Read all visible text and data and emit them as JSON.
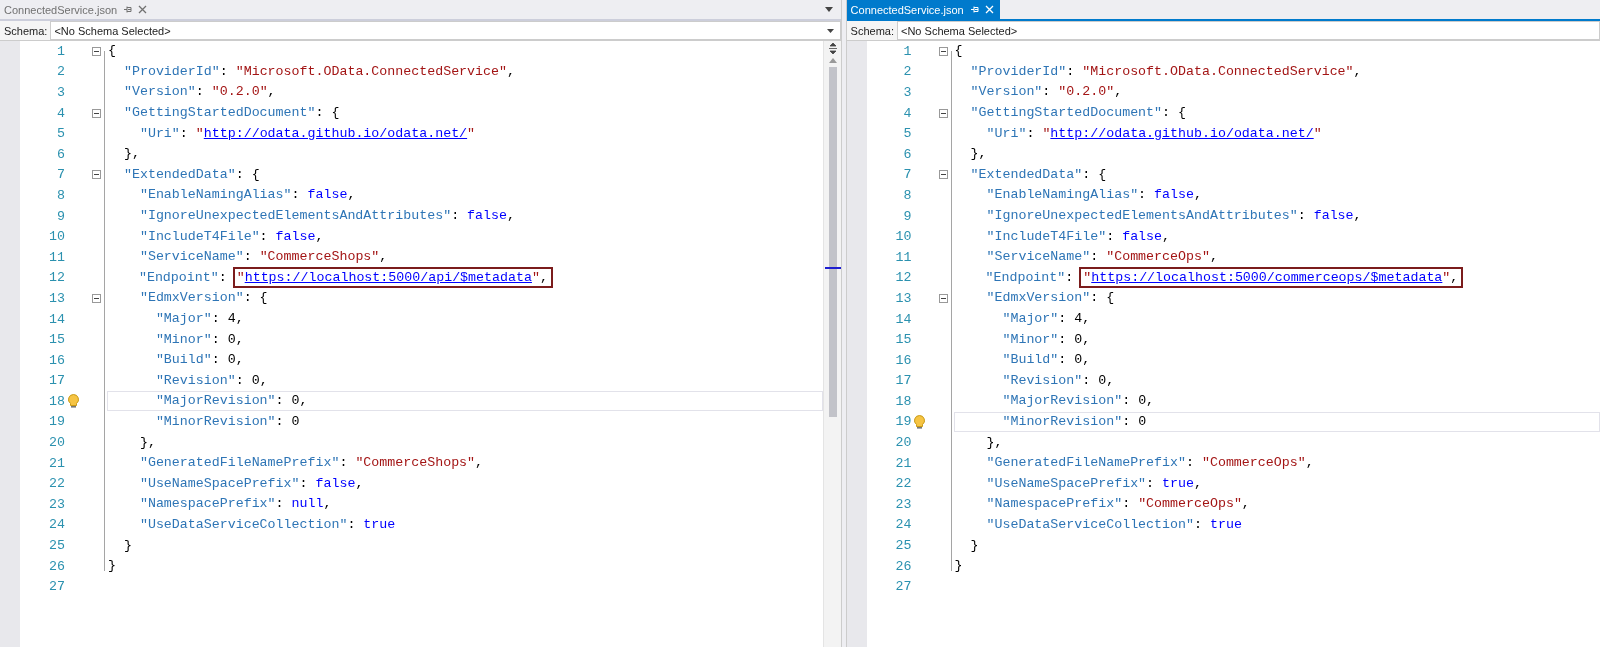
{
  "panes": [
    {
      "tab": {
        "label": "ConnectedService.json",
        "selected": false
      },
      "schema": {
        "label": "Schema:",
        "value": "<No Schema Selected>"
      },
      "scrollbar": true,
      "lines": [
        {
          "n": "1",
          "fold": true,
          "current": false,
          "tokens": [
            {
              "kind": "punctuation",
              "text": "{"
            }
          ]
        },
        {
          "n": "2",
          "fold": false,
          "current": false,
          "tokens": [
            {
              "kind": "key",
              "text": "  \"ProviderId\""
            },
            {
              "kind": "punctuation",
              "text": ": "
            },
            {
              "kind": "string",
              "text": "\"Microsoft.OData.ConnectedService\""
            },
            {
              "kind": "punctuation",
              "text": ","
            }
          ]
        },
        {
          "n": "3",
          "fold": false,
          "current": false,
          "tokens": [
            {
              "kind": "key",
              "text": "  \"Version\""
            },
            {
              "kind": "punctuation",
              "text": ": "
            },
            {
              "kind": "string",
              "text": "\"0.2.0\""
            },
            {
              "kind": "punctuation",
              "text": ","
            }
          ]
        },
        {
          "n": "4",
          "fold": true,
          "current": false,
          "tokens": [
            {
              "kind": "key",
              "text": "  \"GettingStartedDocument\""
            },
            {
              "kind": "punctuation",
              "text": ": {"
            }
          ]
        },
        {
          "n": "5",
          "fold": false,
          "current": false,
          "tokens": [
            {
              "kind": "key",
              "text": "    \"Uri\""
            },
            {
              "kind": "punctuation",
              "text": ": "
            },
            {
              "kind": "string",
              "text": "\""
            },
            {
              "kind": "link",
              "text": "http://odata.github.io/odata.net/"
            },
            {
              "kind": "string",
              "text": "\""
            }
          ]
        },
        {
          "n": "6",
          "fold": false,
          "current": false,
          "tokens": [
            {
              "kind": "punctuation",
              "text": "  },"
            }
          ]
        },
        {
          "n": "7",
          "fold": true,
          "current": false,
          "tokens": [
            {
              "kind": "key",
              "text": "  \"ExtendedData\""
            },
            {
              "kind": "punctuation",
              "text": ": {"
            }
          ]
        },
        {
          "n": "8",
          "fold": false,
          "current": false,
          "tokens": [
            {
              "kind": "key",
              "text": "    \"EnableNamingAlias\""
            },
            {
              "kind": "punctuation",
              "text": ": "
            },
            {
              "kind": "keyword",
              "text": "false"
            },
            {
              "kind": "punctuation",
              "text": ","
            }
          ]
        },
        {
          "n": "9",
          "fold": false,
          "current": false,
          "tokens": [
            {
              "kind": "key",
              "text": "    \"IgnoreUnexpectedElementsAndAttributes\""
            },
            {
              "kind": "punctuation",
              "text": ": "
            },
            {
              "kind": "keyword",
              "text": "false"
            },
            {
              "kind": "punctuation",
              "text": ","
            }
          ]
        },
        {
          "n": "10",
          "fold": false,
          "current": false,
          "tokens": [
            {
              "kind": "key",
              "text": "    \"IncludeT4File\""
            },
            {
              "kind": "punctuation",
              "text": ": "
            },
            {
              "kind": "keyword",
              "text": "false"
            },
            {
              "kind": "punctuation",
              "text": ","
            }
          ]
        },
        {
          "n": "11",
          "fold": false,
          "current": false,
          "tokens": [
            {
              "kind": "key",
              "text": "    \"ServiceName\""
            },
            {
              "kind": "punctuation",
              "text": ": "
            },
            {
              "kind": "string",
              "text": "\"CommerceShops\""
            },
            {
              "kind": "punctuation",
              "text": ","
            }
          ]
        },
        {
          "n": "12",
          "fold": false,
          "current": false,
          "tokens": [
            {
              "kind": "key",
              "text": "    \"Endpoint\""
            },
            {
              "kind": "punctuation",
              "text": ": "
            }
          ],
          "boxed": [
            {
              "kind": "string",
              "text": "\""
            },
            {
              "kind": "link",
              "text": "https://localhost:5000/api/$metadata"
            },
            {
              "kind": "string",
              "text": "\""
            },
            {
              "kind": "punctuation",
              "text": ","
            }
          ]
        },
        {
          "n": "13",
          "fold": true,
          "current": false,
          "tokens": [
            {
              "kind": "key",
              "text": "    \"EdmxVersion\""
            },
            {
              "kind": "punctuation",
              "text": ": {"
            }
          ]
        },
        {
          "n": "14",
          "fold": false,
          "current": false,
          "tokens": [
            {
              "kind": "key",
              "text": "      \"Major\""
            },
            {
              "kind": "punctuation",
              "text": ": "
            },
            {
              "kind": "number",
              "text": "4"
            },
            {
              "kind": "punctuation",
              "text": ","
            }
          ]
        },
        {
          "n": "15",
          "fold": false,
          "current": false,
          "tokens": [
            {
              "kind": "key",
              "text": "      \"Minor\""
            },
            {
              "kind": "punctuation",
              "text": ": "
            },
            {
              "kind": "number",
              "text": "0"
            },
            {
              "kind": "punctuation",
              "text": ","
            }
          ]
        },
        {
          "n": "16",
          "fold": false,
          "current": false,
          "tokens": [
            {
              "kind": "key",
              "text": "      \"Build\""
            },
            {
              "kind": "punctuation",
              "text": ": "
            },
            {
              "kind": "number",
              "text": "0"
            },
            {
              "kind": "punctuation",
              "text": ","
            }
          ]
        },
        {
          "n": "17",
          "fold": false,
          "current": false,
          "tokens": [
            {
              "kind": "key",
              "text": "      \"Revision\""
            },
            {
              "kind": "punctuation",
              "text": ": "
            },
            {
              "kind": "number",
              "text": "0"
            },
            {
              "kind": "punctuation",
              "text": ","
            }
          ]
        },
        {
          "n": "18",
          "fold": false,
          "current": true,
          "tokens": [
            {
              "kind": "key",
              "text": "      \"MajorRevision\""
            },
            {
              "kind": "punctuation",
              "text": ": "
            },
            {
              "kind": "number",
              "text": "0"
            },
            {
              "kind": "punctuation",
              "text": ","
            }
          ]
        },
        {
          "n": "19",
          "fold": false,
          "current": false,
          "tokens": [
            {
              "kind": "key",
              "text": "      \"MinorRevision\""
            },
            {
              "kind": "punctuation",
              "text": ": "
            },
            {
              "kind": "number",
              "text": "0"
            }
          ]
        },
        {
          "n": "20",
          "fold": false,
          "current": false,
          "tokens": [
            {
              "kind": "punctuation",
              "text": "    },"
            }
          ]
        },
        {
          "n": "21",
          "fold": false,
          "current": false,
          "tokens": [
            {
              "kind": "key",
              "text": "    \"GeneratedFileNamePrefix\""
            },
            {
              "kind": "punctuation",
              "text": ": "
            },
            {
              "kind": "string",
              "text": "\"CommerceShops\""
            },
            {
              "kind": "punctuation",
              "text": ","
            }
          ]
        },
        {
          "n": "22",
          "fold": false,
          "current": false,
          "tokens": [
            {
              "kind": "key",
              "text": "    \"UseNameSpacePrefix\""
            },
            {
              "kind": "punctuation",
              "text": ": "
            },
            {
              "kind": "keyword",
              "text": "false"
            },
            {
              "kind": "punctuation",
              "text": ","
            }
          ]
        },
        {
          "n": "23",
          "fold": false,
          "current": false,
          "tokens": [
            {
              "kind": "key",
              "text": "    \"NamespacePrefix\""
            },
            {
              "kind": "punctuation",
              "text": ": "
            },
            {
              "kind": "keyword",
              "text": "null"
            },
            {
              "kind": "punctuation",
              "text": ","
            }
          ]
        },
        {
          "n": "24",
          "fold": false,
          "current": false,
          "tokens": [
            {
              "kind": "key",
              "text": "    \"UseDataServiceCollection\""
            },
            {
              "kind": "punctuation",
              "text": ": "
            },
            {
              "kind": "keyword",
              "text": "true"
            }
          ]
        },
        {
          "n": "25",
          "fold": false,
          "current": false,
          "tokens": [
            {
              "kind": "punctuation",
              "text": "  }"
            }
          ]
        },
        {
          "n": "26",
          "fold": false,
          "current": false,
          "tokens": [
            {
              "kind": "punctuation",
              "text": "}"
            }
          ]
        },
        {
          "n": "27",
          "fold": false,
          "current": false
        }
      ]
    },
    {
      "tab": {
        "label": "ConnectedService.json",
        "selected": true
      },
      "schema": {
        "label": "Schema:",
        "value": "<No Schema Selected>"
      },
      "scrollbar": false,
      "lines": [
        {
          "n": "1",
          "fold": true,
          "current": false,
          "tokens": [
            {
              "kind": "punctuation",
              "text": "{"
            }
          ]
        },
        {
          "n": "2",
          "fold": false,
          "current": false,
          "tokens": [
            {
              "kind": "key",
              "text": "  \"ProviderId\""
            },
            {
              "kind": "punctuation",
              "text": ": "
            },
            {
              "kind": "string",
              "text": "\"Microsoft.OData.ConnectedService\""
            },
            {
              "kind": "punctuation",
              "text": ","
            }
          ]
        },
        {
          "n": "3",
          "fold": false,
          "current": false,
          "tokens": [
            {
              "kind": "key",
              "text": "  \"Version\""
            },
            {
              "kind": "punctuation",
              "text": ": "
            },
            {
              "kind": "string",
              "text": "\"0.2.0\""
            },
            {
              "kind": "punctuation",
              "text": ","
            }
          ]
        },
        {
          "n": "4",
          "fold": true,
          "current": false,
          "tokens": [
            {
              "kind": "key",
              "text": "  \"GettingStartedDocument\""
            },
            {
              "kind": "punctuation",
              "text": ": {"
            }
          ]
        },
        {
          "n": "5",
          "fold": false,
          "current": false,
          "tokens": [
            {
              "kind": "key",
              "text": "    \"Uri\""
            },
            {
              "kind": "punctuation",
              "text": ": "
            },
            {
              "kind": "string",
              "text": "\""
            },
            {
              "kind": "link",
              "text": "http://odata.github.io/odata.net/"
            },
            {
              "kind": "string",
              "text": "\""
            }
          ]
        },
        {
          "n": "6",
          "fold": false,
          "current": false,
          "tokens": [
            {
              "kind": "punctuation",
              "text": "  },"
            }
          ]
        },
        {
          "n": "7",
          "fold": true,
          "current": false,
          "tokens": [
            {
              "kind": "key",
              "text": "  \"ExtendedData\""
            },
            {
              "kind": "punctuation",
              "text": ": {"
            }
          ]
        },
        {
          "n": "8",
          "fold": false,
          "current": false,
          "tokens": [
            {
              "kind": "key",
              "text": "    \"EnableNamingAlias\""
            },
            {
              "kind": "punctuation",
              "text": ": "
            },
            {
              "kind": "keyword",
              "text": "false"
            },
            {
              "kind": "punctuation",
              "text": ","
            }
          ]
        },
        {
          "n": "9",
          "fold": false,
          "current": false,
          "tokens": [
            {
              "kind": "key",
              "text": "    \"IgnoreUnexpectedElementsAndAttributes\""
            },
            {
              "kind": "punctuation",
              "text": ": "
            },
            {
              "kind": "keyword",
              "text": "false"
            },
            {
              "kind": "punctuation",
              "text": ","
            }
          ]
        },
        {
          "n": "10",
          "fold": false,
          "current": false,
          "tokens": [
            {
              "kind": "key",
              "text": "    \"IncludeT4File\""
            },
            {
              "kind": "punctuation",
              "text": ": "
            },
            {
              "kind": "keyword",
              "text": "false"
            },
            {
              "kind": "punctuation",
              "text": ","
            }
          ]
        },
        {
          "n": "11",
          "fold": false,
          "current": false,
          "tokens": [
            {
              "kind": "key",
              "text": "    \"ServiceName\""
            },
            {
              "kind": "punctuation",
              "text": ": "
            },
            {
              "kind": "string",
              "text": "\"CommerceOps\""
            },
            {
              "kind": "punctuation",
              "text": ","
            }
          ]
        },
        {
          "n": "12",
          "fold": false,
          "current": false,
          "tokens": [
            {
              "kind": "key",
              "text": "    \"Endpoint\""
            },
            {
              "kind": "punctuation",
              "text": ": "
            }
          ],
          "boxed": [
            {
              "kind": "string",
              "text": "\""
            },
            {
              "kind": "link",
              "text": "https://localhost:5000/commerceops/$metadata"
            },
            {
              "kind": "string",
              "text": "\""
            },
            {
              "kind": "punctuation",
              "text": ","
            }
          ]
        },
        {
          "n": "13",
          "fold": true,
          "current": false,
          "tokens": [
            {
              "kind": "key",
              "text": "    \"EdmxVersion\""
            },
            {
              "kind": "punctuation",
              "text": ": {"
            }
          ]
        },
        {
          "n": "14",
          "fold": false,
          "current": false,
          "tokens": [
            {
              "kind": "key",
              "text": "      \"Major\""
            },
            {
              "kind": "punctuation",
              "text": ": "
            },
            {
              "kind": "number",
              "text": "4"
            },
            {
              "kind": "punctuation",
              "text": ","
            }
          ]
        },
        {
          "n": "15",
          "fold": false,
          "current": false,
          "tokens": [
            {
              "kind": "key",
              "text": "      \"Minor\""
            },
            {
              "kind": "punctuation",
              "text": ": "
            },
            {
              "kind": "number",
              "text": "0"
            },
            {
              "kind": "punctuation",
              "text": ","
            }
          ]
        },
        {
          "n": "16",
          "fold": false,
          "current": false,
          "tokens": [
            {
              "kind": "key",
              "text": "      \"Build\""
            },
            {
              "kind": "punctuation",
              "text": ": "
            },
            {
              "kind": "number",
              "text": "0"
            },
            {
              "kind": "punctuation",
              "text": ","
            }
          ]
        },
        {
          "n": "17",
          "fold": false,
          "current": false,
          "tokens": [
            {
              "kind": "key",
              "text": "      \"Revision\""
            },
            {
              "kind": "punctuation",
              "text": ": "
            },
            {
              "kind": "number",
              "text": "0"
            },
            {
              "kind": "punctuation",
              "text": ","
            }
          ]
        },
        {
          "n": "18",
          "fold": false,
          "current": false,
          "tokens": [
            {
              "kind": "key",
              "text": "      \"MajorRevision\""
            },
            {
              "kind": "punctuation",
              "text": ": "
            },
            {
              "kind": "number",
              "text": "0"
            },
            {
              "kind": "punctuation",
              "text": ","
            }
          ]
        },
        {
          "n": "19",
          "fold": false,
          "current": true,
          "tokens": [
            {
              "kind": "key",
              "text": "      \"MinorRevision\""
            },
            {
              "kind": "punctuation",
              "text": ": "
            },
            {
              "kind": "number",
              "text": "0"
            }
          ]
        },
        {
          "n": "20",
          "fold": false,
          "current": false,
          "tokens": [
            {
              "kind": "punctuation",
              "text": "    },"
            }
          ]
        },
        {
          "n": "21",
          "fold": false,
          "current": false,
          "tokens": [
            {
              "kind": "key",
              "text": "    \"GeneratedFileNamePrefix\""
            },
            {
              "kind": "punctuation",
              "text": ": "
            },
            {
              "kind": "string",
              "text": "\"CommerceOps\""
            },
            {
              "kind": "punctuation",
              "text": ","
            }
          ]
        },
        {
          "n": "22",
          "fold": false,
          "current": false,
          "tokens": [
            {
              "kind": "key",
              "text": "    \"UseNameSpacePrefix\""
            },
            {
              "kind": "punctuation",
              "text": ": "
            },
            {
              "kind": "keyword",
              "text": "true"
            },
            {
              "kind": "punctuation",
              "text": ","
            }
          ]
        },
        {
          "n": "23",
          "fold": false,
          "current": false,
          "tokens": [
            {
              "kind": "key",
              "text": "    \"NamespacePrefix\""
            },
            {
              "kind": "punctuation",
              "text": ": "
            },
            {
              "kind": "string",
              "text": "\"CommerceOps\""
            },
            {
              "kind": "punctuation",
              "text": ","
            }
          ]
        },
        {
          "n": "24",
          "fold": false,
          "current": false,
          "tokens": [
            {
              "kind": "key",
              "text": "    \"UseDataServiceCollection\""
            },
            {
              "kind": "punctuation",
              "text": ": "
            },
            {
              "kind": "keyword",
              "text": "true"
            }
          ]
        },
        {
          "n": "25",
          "fold": false,
          "current": false,
          "tokens": [
            {
              "kind": "punctuation",
              "text": "  }"
            }
          ]
        },
        {
          "n": "26",
          "fold": false,
          "current": false,
          "tokens": [
            {
              "kind": "punctuation",
              "text": "}"
            }
          ]
        },
        {
          "n": "27",
          "fold": false,
          "current": false
        }
      ]
    }
  ]
}
